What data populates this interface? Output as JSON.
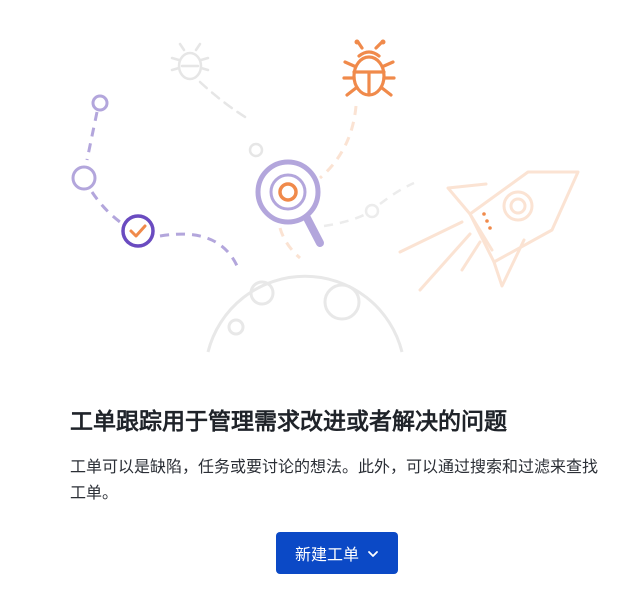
{
  "empty_state": {
    "title": "工单跟踪用于管理需求改进或者解决的问题",
    "description": "工单可以是缺陷，任务或要讨论的想法。此外，可以通过搜索和过滤来查找工单。",
    "button_label": "新建工单"
  },
  "colors": {
    "primary_button": "#0b49c6",
    "purple_accent": "#b3a6dc",
    "check_purple": "#6a4bc0",
    "orange_accent": "#f08a4b",
    "light_peach": "#fbe3d3",
    "planet_gray": "#e6e6e6"
  },
  "icons": [
    "bug-icon",
    "magnifier-icon",
    "check-circle-icon",
    "rocket-icon",
    "planet-icon",
    "chevron-down-icon"
  ]
}
